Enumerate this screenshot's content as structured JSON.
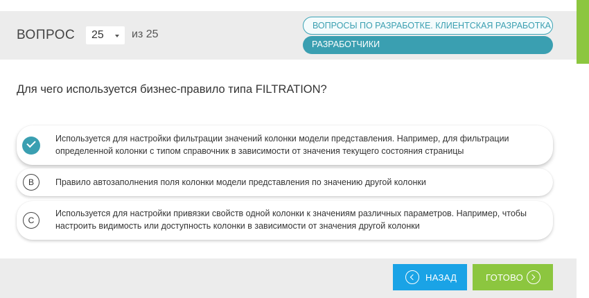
{
  "header": {
    "title": "ВОПРОС",
    "question_number": "25",
    "total_label": "из 25",
    "tags": [
      "ВОПРОСЫ ПО РАЗРАБОТКЕ. КЛИЕНТСКАЯ РАЗРАБОТКА",
      "РАЗРАБОТЧИКИ"
    ]
  },
  "question": {
    "text": "Для чего используется бизнес-правило типа FILTRATION?"
  },
  "answers": [
    {
      "marker": "",
      "selected": true,
      "text": "Используется для настройки фильтрации значений колонки модели представления. Например, для фильтрации определенной колонки с типом справочник в зависимости от значения текущего состояния страницы"
    },
    {
      "marker": "B",
      "selected": false,
      "text": "Правило автозаполнения поля колонки модели представления по значению другой колонки"
    },
    {
      "marker": "C",
      "selected": false,
      "text": "Используется для настройки привязки свойств одной колонки к значениям различных параметров. Например, чтобы настроить видимость или доступность колонки в зависимости от значения другой колонки"
    }
  ],
  "footer": {
    "back_label": "НАЗАД",
    "done_label": "ГОТОВО"
  },
  "colors": {
    "accent": "#3a9fb1",
    "back_button": "#1aa3e6",
    "done_button": "#8cc63f",
    "panel_background": "#ececec"
  },
  "icons": {
    "selected": "check-icon",
    "back": "chevron-left-circle-icon",
    "done": "chevron-right-circle-icon",
    "select": "caret-down-icon"
  }
}
